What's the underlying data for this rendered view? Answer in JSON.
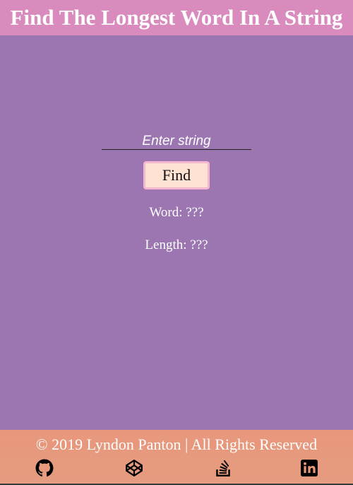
{
  "header": {
    "title": "Find The Longest Word In A String"
  },
  "form": {
    "input_placeholder": "Enter string",
    "input_value": "",
    "find_label": "Find"
  },
  "results": {
    "word_text": "Word: ???",
    "length_text": "Length: ???"
  },
  "footer": {
    "copyright": "© 2019 Lyndon Panton | All Rights Reserved",
    "social": [
      {
        "icon": "github-icon"
      },
      {
        "icon": "codepen-icon"
      },
      {
        "icon": "stackoverflow-icon"
      },
      {
        "icon": "linkedin-icon"
      }
    ]
  },
  "colors": {
    "background": "#9b76b0",
    "header": "#d98bbd",
    "footer": "#e8977b",
    "button_fill": "#ffe3d2",
    "button_border": "#f7b6cf",
    "text": "#ffffff"
  }
}
